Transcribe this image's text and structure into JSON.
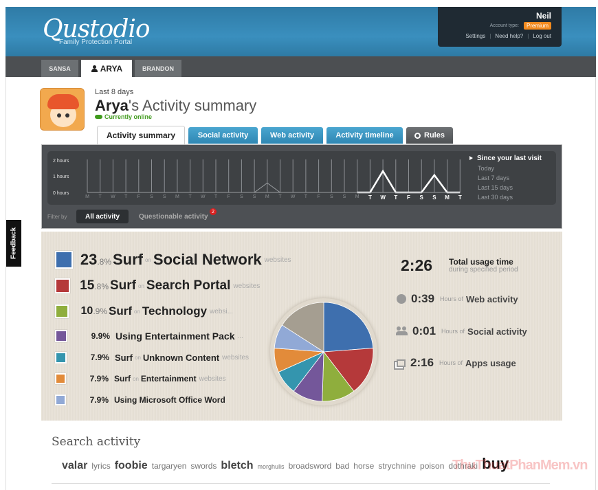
{
  "brand": {
    "logo": "Qustodio",
    "tagline": "Family Protection Portal"
  },
  "account": {
    "name": "Neil",
    "type_label": "Account type:",
    "type_value": "Premium",
    "links": [
      "Settings",
      "Need help?",
      "Log out"
    ]
  },
  "children_tabs": [
    "SANSA",
    "ARYA",
    "BRANDON"
  ],
  "profile": {
    "period": "Last 8 days",
    "name": "Arya",
    "title_rest": "'s Activity summary",
    "status": "Currently online"
  },
  "section_tabs": [
    "Activity summary",
    "Social activity",
    "Web activity",
    "Activity timeline",
    "Rules"
  ],
  "timeline": {
    "y_labels": [
      "2 hours",
      "1 hours",
      "0 hours"
    ],
    "days": [
      "M",
      "T",
      "W",
      "T",
      "F",
      "S",
      "S",
      "M",
      "T",
      "W",
      "T",
      "F",
      "S",
      "S",
      "M",
      "T",
      "W",
      "T",
      "F",
      "S",
      "S",
      "M",
      "T",
      "W",
      "T",
      "F",
      "S",
      "S",
      "M",
      "T"
    ],
    "bold_days": [
      "T",
      "W",
      "T",
      "F",
      "S",
      "S",
      "M",
      "T"
    ],
    "ranges": [
      "Since your last visit",
      "Today",
      "Last 7 days",
      "Last 15 days",
      "Last 30 days"
    ],
    "filter_label": "Filter by",
    "filters": [
      "All activity",
      "Questionable activity"
    ],
    "questionable_count": "2"
  },
  "categories": [
    {
      "pct_int": "23",
      "pct_dec": ".8%",
      "action": "Surf",
      "on": "on",
      "target": "Social Network",
      "suffix": "websites",
      "color": "#3e6fae"
    },
    {
      "pct_int": "15",
      "pct_dec": ".8%",
      "action": "Surf",
      "on": "on",
      "target": "Search Portal",
      "suffix": "websites",
      "color": "#b5393a"
    },
    {
      "pct_int": "10",
      "pct_dec": ".9%",
      "action": "Surf",
      "on": "on",
      "target": "Technology",
      "suffix": "websi...",
      "color": "#8fae3d"
    },
    {
      "pct_int": "9.9%",
      "pct_dec": "",
      "action": "Using Entertainment Pack",
      "on": "",
      "target": "",
      "suffix": "...",
      "color": "#74579a"
    },
    {
      "pct_int": "7.9%",
      "pct_dec": "",
      "action": "Surf",
      "on": "on",
      "target": "Unknown Content",
      "suffix": "websites",
      "color": "#3495ae"
    },
    {
      "pct_int": "7.9%",
      "pct_dec": "",
      "action": "Surf",
      "on": "on",
      "target": "Entertainment",
      "suffix": "websites",
      "color": "#e28b3a"
    },
    {
      "pct_int": "7.9%",
      "pct_dec": "",
      "action": "Using Microsoft Office Word",
      "on": "",
      "target": "",
      "suffix": "",
      "color": "#91a9d6"
    }
  ],
  "pie": {
    "slices": [
      {
        "label": "Social Network",
        "value": 23.8,
        "color": "#3e6fae"
      },
      {
        "label": "Search Portal",
        "value": 15.8,
        "color": "#b5393a"
      },
      {
        "label": "Technology",
        "value": 10.9,
        "color": "#8fae3d"
      },
      {
        "label": "Entertainment Pack",
        "value": 9.9,
        "color": "#74579a"
      },
      {
        "label": "Unknown Content",
        "value": 7.9,
        "color": "#3495ae"
      },
      {
        "label": "Entertainment",
        "value": 7.9,
        "color": "#e28b3a"
      },
      {
        "label": "Microsoft Office Word",
        "value": 7.9,
        "color": "#91a9d6"
      },
      {
        "label": "Other",
        "value": 15.9,
        "color": "#a59e91"
      }
    ]
  },
  "totals": {
    "total_value": "2:26",
    "total_label": "Total usage time",
    "total_sub": "during specified period",
    "web": {
      "value": "0:39",
      "hours_of": "Hours of",
      "label": "Web activity"
    },
    "social": {
      "value": "0:01",
      "hours_of": "Hours of",
      "label": "Social activity"
    },
    "apps": {
      "value": "2:16",
      "hours_of": "Hours of",
      "label": "Apps usage"
    }
  },
  "search": {
    "title": "Search activity",
    "terms": [
      {
        "text": "valar",
        "size": 16,
        "bold": true
      },
      {
        "text": "lyrics",
        "size": 12,
        "bold": false
      },
      {
        "text": "foobie",
        "size": 16,
        "bold": true
      },
      {
        "text": "targaryen",
        "size": 12,
        "bold": false
      },
      {
        "text": "swords",
        "size": 12,
        "bold": false
      },
      {
        "text": "bletch",
        "size": 16,
        "bold": true
      },
      {
        "text": "morghulis",
        "size": 9,
        "bold": false
      },
      {
        "text": "broadsword",
        "size": 12,
        "bold": false
      },
      {
        "text": "bad",
        "size": 12,
        "bold": false
      },
      {
        "text": "horse",
        "size": 12,
        "bold": false
      },
      {
        "text": "strychnine",
        "size": 12,
        "bold": false
      },
      {
        "text": "poison",
        "size": 12,
        "bold": false
      },
      {
        "text": "dothraki",
        "size": 12,
        "bold": false
      },
      {
        "text": "buy",
        "size": 22,
        "bold": true
      }
    ]
  },
  "feedback": "Feedback",
  "watermark": "ThuThuatPhanMem.vn"
}
